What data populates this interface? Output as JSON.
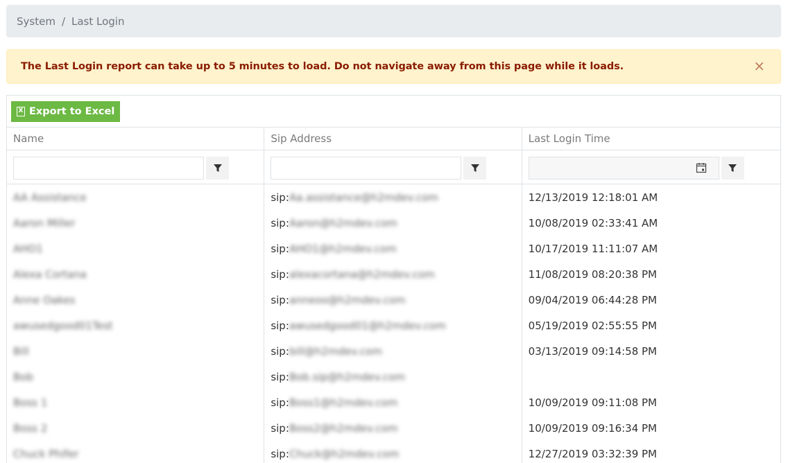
{
  "breadcrumb": {
    "root": "System",
    "separator": "/",
    "current": "Last Login"
  },
  "alert": {
    "message": "The Last Login report can take up to 5 minutes to load. Do not navigate away from this page while it loads.",
    "close_symbol": "×"
  },
  "toolbar": {
    "export_label": "Export to Excel",
    "export_icon": "excel-icon"
  },
  "columns": [
    "Name",
    "Sip Address",
    "Last Login Time"
  ],
  "colors": {
    "export_button": "#6cb944",
    "alert_bg": "#fff3cd",
    "alert_text": "#8a1c00",
    "breadcrumb_bg": "#e9ecef"
  },
  "rows": [
    {
      "name": "AA Assistance",
      "sip_prefix": "sip:",
      "sip": "Aa.assistance@h2mdev.com",
      "time": "12/13/2019 12:18:01 AM"
    },
    {
      "name": "Aaron Miller",
      "sip_prefix": "sip:",
      "sip": "Aaron@h2mdev.com",
      "time": "10/08/2019 02:33:41 AM"
    },
    {
      "name": "AHO1",
      "sip_prefix": "sip:",
      "sip": "AHO1@h2mdev.com",
      "time": "10/17/2019 11:11:07 AM"
    },
    {
      "name": "Alexa Cortana",
      "sip_prefix": "sip:",
      "sip": "alexacortana@h2mdev.com",
      "time": "11/08/2019 08:20:38 PM"
    },
    {
      "name": "Anne Oakes",
      "sip_prefix": "sip:",
      "sip": "anneoo@h2mdev.com",
      "time": "09/04/2019 06:44:28 PM"
    },
    {
      "name": "awusedgood01Test",
      "sip_prefix": "sip:",
      "sip": "awusedgood01@h2mdev.com",
      "time": "05/19/2019 02:55:55 PM"
    },
    {
      "name": "Bill",
      "sip_prefix": "sip:",
      "sip": "bill@h2mdev.com",
      "time": "03/13/2019 09:14:58 PM"
    },
    {
      "name": "Bob",
      "sip_prefix": "sip:",
      "sip": "Bob.sip@h2mdev.com",
      "time": ""
    },
    {
      "name": "Boss 1",
      "sip_prefix": "sip:",
      "sip": "Boss1@h2mdev.com",
      "time": "10/09/2019 09:11:08 PM"
    },
    {
      "name": "Boss 2",
      "sip_prefix": "sip:",
      "sip": "Boss2@h2mdev.com",
      "time": "10/09/2019 09:16:34 PM"
    },
    {
      "name": "Chuck Phifer",
      "sip_prefix": "sip:",
      "sip": "Chuck@h2mdev.com",
      "time": "12/27/2019 03:32:39 PM"
    }
  ]
}
